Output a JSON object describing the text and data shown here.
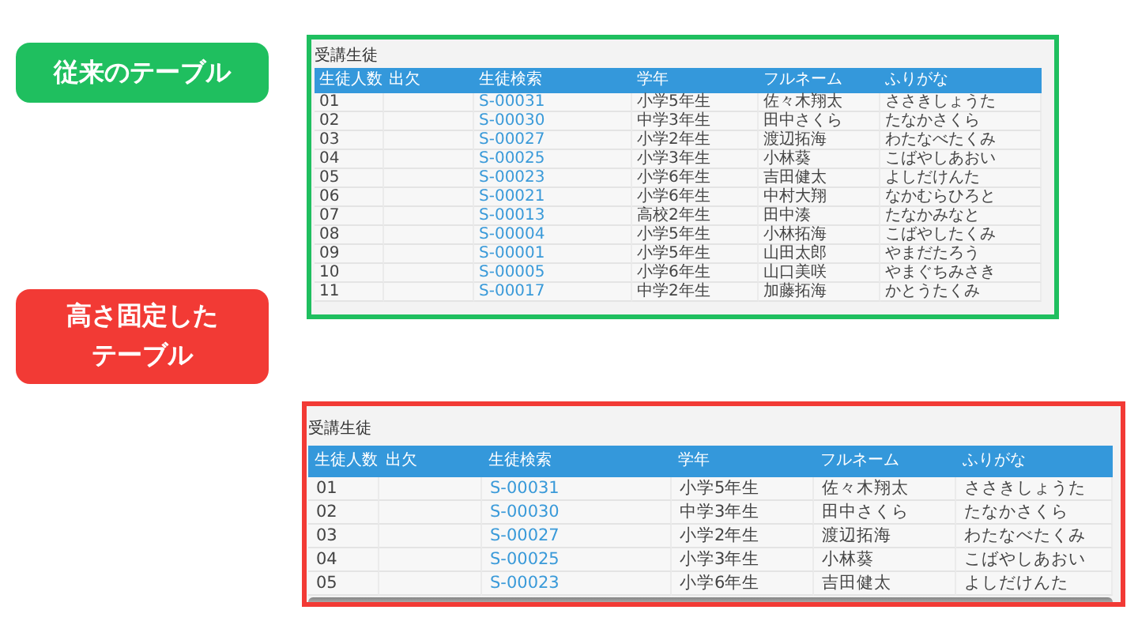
{
  "panels": [
    {
      "label": [
        "従来のテーブル"
      ],
      "color": "#1fbf5f",
      "fixed_height": false,
      "title": "受講生徒",
      "columns": [
        "生徒人数",
        "出欠",
        "生徒検索",
        "学年",
        "フルネーム",
        "ふりがな"
      ],
      "rows": [
        [
          "01",
          "",
          "S-00031",
          "小学5年生",
          "佐々木翔太",
          "ささきしょうた"
        ],
        [
          "02",
          "",
          "S-00030",
          "中学3年生",
          "田中さくら",
          "たなかさくら"
        ],
        [
          "03",
          "",
          "S-00027",
          "小学2年生",
          "渡辺拓海",
          "わたなべたくみ"
        ],
        [
          "04",
          "",
          "S-00025",
          "小学3年生",
          "小林葵",
          "こばやしあおい"
        ],
        [
          "05",
          "",
          "S-00023",
          "小学6年生",
          "吉田健太",
          "よしだけんた"
        ],
        [
          "06",
          "",
          "S-00021",
          "小学6年生",
          "中村大翔",
          "なかむらひろと"
        ],
        [
          "07",
          "",
          "S-00013",
          "高校2年生",
          "田中湊",
          "たなかみなと"
        ],
        [
          "08",
          "",
          "S-00004",
          "小学5年生",
          "小林拓海",
          "こばやしたくみ"
        ],
        [
          "09",
          "",
          "S-00001",
          "小学5年生",
          "山田太郎",
          "やまだたろう"
        ],
        [
          "10",
          "",
          "S-00005",
          "小学6年生",
          "山口美咲",
          "やまぐちみさき"
        ],
        [
          "11",
          "",
          "S-00017",
          "中学2年生",
          "加藤拓海",
          "かとうたくみ"
        ]
      ]
    },
    {
      "label": [
        "高さ固定した",
        "テーブル"
      ],
      "color": "#f23a35",
      "fixed_height": true,
      "title": "受講生徒",
      "columns": [
        "生徒人数",
        "出欠",
        "生徒検索",
        "学年",
        "フルネーム",
        "ふりがな"
      ],
      "rows": [
        [
          "01",
          "",
          "S-00031",
          "小学5年生",
          "佐々木翔太",
          "ささきしょうた"
        ],
        [
          "02",
          "",
          "S-00030",
          "中学3年生",
          "田中さくら",
          "たなかさくら"
        ],
        [
          "03",
          "",
          "S-00027",
          "小学2年生",
          "渡辺拓海",
          "わたなべたくみ"
        ],
        [
          "04",
          "",
          "S-00025",
          "小学3年生",
          "小林葵",
          "こばやしあおい"
        ],
        [
          "05",
          "",
          "S-00023",
          "小学6年生",
          "吉田健太",
          "よしだけんた"
        ]
      ]
    }
  ]
}
